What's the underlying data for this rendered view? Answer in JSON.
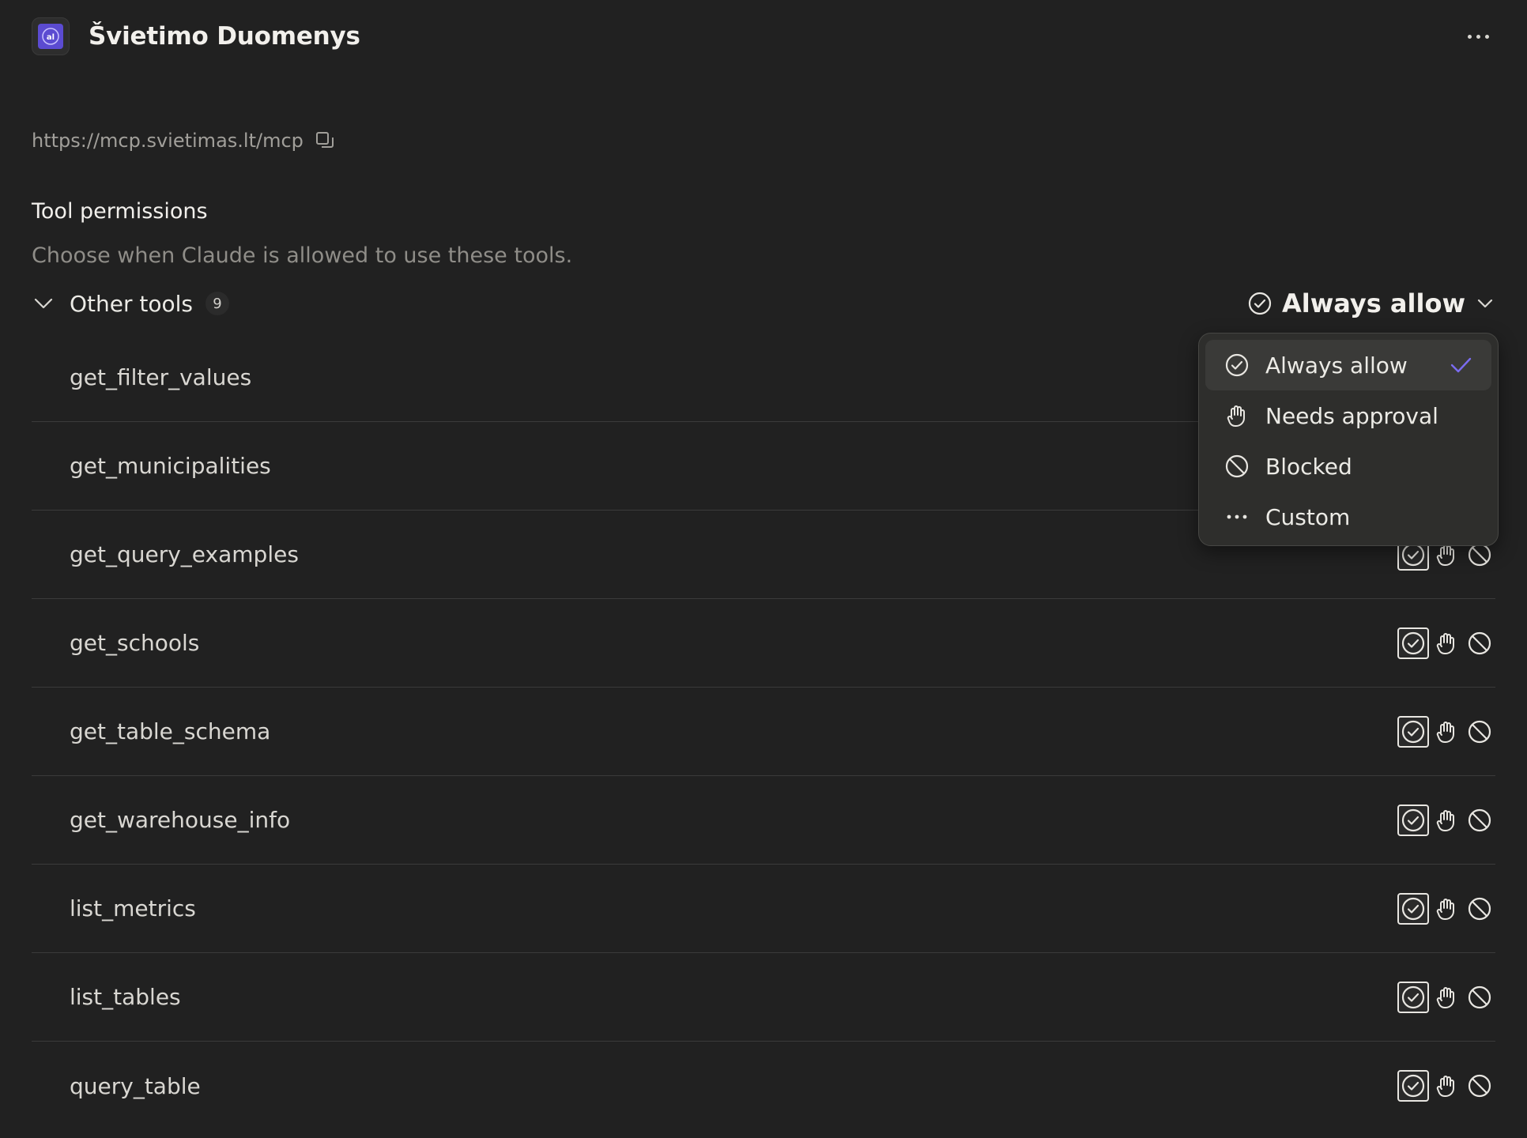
{
  "header": {
    "title": "Švietimo Duomenys",
    "logo_glyph": "al"
  },
  "server": {
    "url": "https://mcp.svietimas.lt/mcp"
  },
  "permissions": {
    "title": "Tool permissions",
    "description": "Choose when Claude is allowed to use these tools."
  },
  "group": {
    "label": "Other tools",
    "count": "9",
    "selected_permission": "Always allow"
  },
  "tools": [
    {
      "name": "get_filter_values",
      "permission": "always"
    },
    {
      "name": "get_municipalities",
      "permission": "always"
    },
    {
      "name": "get_query_examples",
      "permission": "always"
    },
    {
      "name": "get_schools",
      "permission": "always"
    },
    {
      "name": "get_table_schema",
      "permission": "always"
    },
    {
      "name": "get_warehouse_info",
      "permission": "always"
    },
    {
      "name": "list_metrics",
      "permission": "always"
    },
    {
      "name": "list_tables",
      "permission": "always"
    },
    {
      "name": "query_table",
      "permission": "always"
    }
  ],
  "dropdown": {
    "items": [
      {
        "label": "Always allow",
        "icon": "check-circle-icon",
        "selected": true
      },
      {
        "label": "Needs approval",
        "icon": "hand-icon",
        "selected": false
      },
      {
        "label": "Blocked",
        "icon": "blocked-icon",
        "selected": false
      },
      {
        "label": "Custom",
        "icon": "more-dots-icon",
        "selected": false
      }
    ]
  },
  "colors": {
    "background": "#212121",
    "accent": "#7b6cf0",
    "logo": "#5b4bd1"
  }
}
